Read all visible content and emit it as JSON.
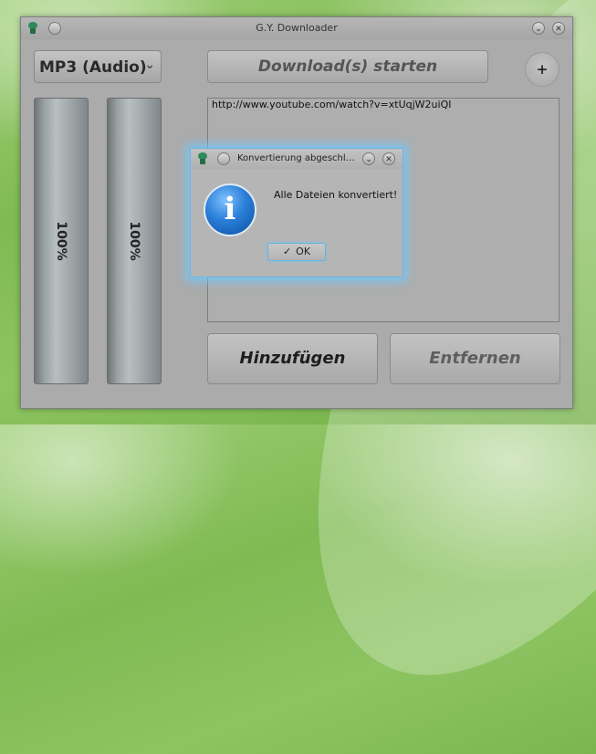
{
  "window": {
    "title": "G.Y. Downloader",
    "minimize_glyph": "⌄",
    "close_glyph": "✕"
  },
  "format_select": {
    "selected": "MP3 (Audio)",
    "arrow": "⌄"
  },
  "progress_bars": [
    {
      "text": "100%",
      "value": 1.0
    },
    {
      "text": "100%",
      "value": 1.0
    }
  ],
  "toolbar": {
    "download_label": "Download(s) starten",
    "plus_label": "+"
  },
  "url_list": {
    "items": [
      "http://www.youtube.com/watch?v=xtUqjW2uiQI"
    ]
  },
  "buttons": {
    "add_label": "Hinzufügen",
    "remove_label": "Entfernen"
  },
  "dialog": {
    "title": "Konvertierung abgeschl…",
    "message": "Alle Dateien konvertiert!",
    "ok_label": "OK",
    "ok_icon": "✓",
    "info_glyph": "i",
    "minimize_glyph": "⌄",
    "close_glyph": "✕"
  },
  "colors": {
    "accent_glow": "#6ab6e8",
    "info_blue": "#2a7fd8"
  }
}
